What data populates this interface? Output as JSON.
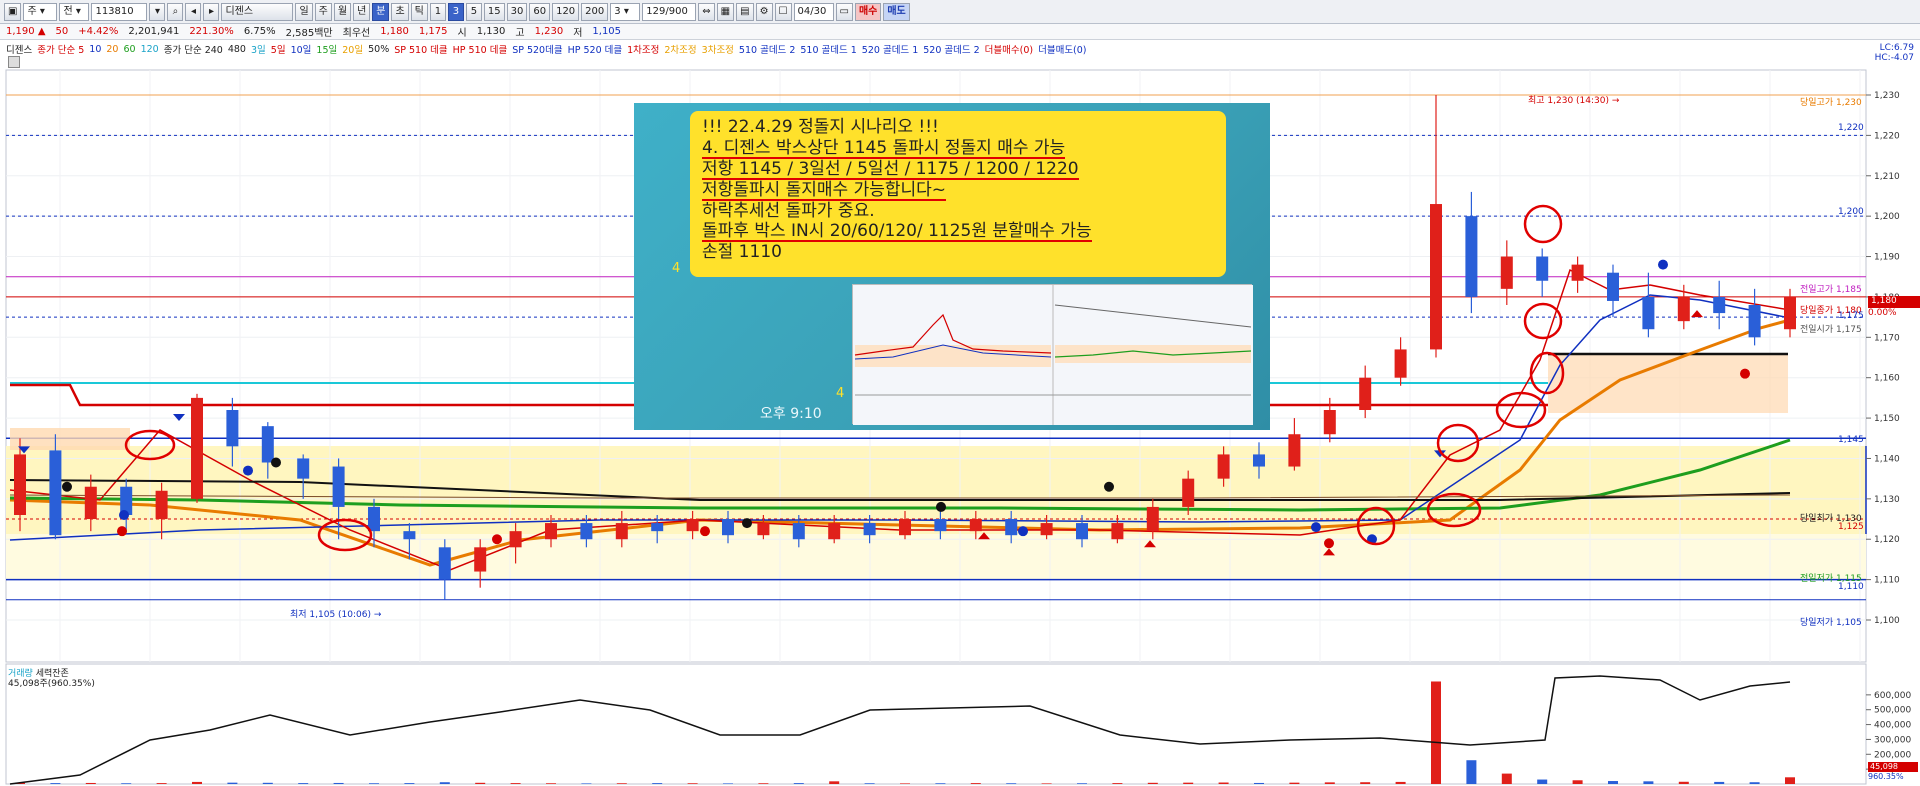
{
  "toolbar": {
    "code": "113810",
    "name": "디젠스",
    "periods": [
      "일",
      "주",
      "월",
      "년",
      "분",
      "초",
      "틱"
    ],
    "intervals": [
      "1",
      "3",
      "5",
      "15",
      "30",
      "60",
      "120",
      "200"
    ],
    "interval_select": "3",
    "page_count": "129/900",
    "date_box": "04/30",
    "buy": "매수",
    "sell": "매도",
    "sub_dropdown": "주",
    "sub_dropdown2": "전"
  },
  "quote": {
    "price": "1,190",
    "change": "50",
    "change_pct": "+4.42%",
    "volume": "2,201,941",
    "volume_pct": "221.30%",
    "turnover_pct": "6.75%",
    "amount": "2,585백만",
    "pref_label": "최우선",
    "ask": "1,180",
    "bid": "1,175",
    "open_label": "시",
    "open": "1,130",
    "high_label": "고",
    "high": "1,230",
    "low_label": "저",
    "low": "1,105"
  },
  "legend": [
    {
      "text": "디젠스",
      "color": "#222222"
    },
    {
      "text": "종가 단순 5",
      "color": "#d40000"
    },
    {
      "text": "10",
      "color": "#1030c0"
    },
    {
      "text": "20",
      "color": "#e87b00"
    },
    {
      "text": "60",
      "color": "#1e9e1e"
    },
    {
      "text": "120",
      "color": "#1aa3c8"
    },
    {
      "text": "종가 단순 240",
      "color": "#222222"
    },
    {
      "text": "480",
      "color": "#222222"
    },
    {
      "text": "3일",
      "color": "#1aa3c8"
    },
    {
      "text": "5일",
      "color": "#d40000"
    },
    {
      "text": "10일",
      "color": "#1030c0"
    },
    {
      "text": "15일",
      "color": "#1e9e1e"
    },
    {
      "text": "20일",
      "color": "#e8a000"
    },
    {
      "text": "50%",
      "color": "#222222"
    },
    {
      "text": "SP 510 데클",
      "color": "#d40000"
    },
    {
      "text": "HP 510 데클",
      "color": "#d40000"
    },
    {
      "text": "SP 520데클",
      "color": "#1030c0"
    },
    {
      "text": "HP 520 데클",
      "color": "#1030c0"
    },
    {
      "text": "1차조정",
      "color": "#d40000"
    },
    {
      "text": "2차조정",
      "color": "#e8a000"
    },
    {
      "text": "3차조정",
      "color": "#e8a000"
    },
    {
      "text": "510 골데드 2",
      "color": "#1030c0"
    },
    {
      "text": "510 골데드 1",
      "color": "#1030c0"
    },
    {
      "text": "520 골데드 1",
      "color": "#1030c0"
    },
    {
      "text": "520 골데드 2",
      "color": "#1030c0"
    },
    {
      "text": "더블매수(0)",
      "color": "#d40000"
    },
    {
      "text": "더블매도(0)",
      "color": "#1030c0"
    }
  ],
  "right_info": {
    "lc": "LC:6.79",
    "hc": "HC:-4.07"
  },
  "price_axis": {
    "ticks": [
      "1,230",
      "1,220",
      "1,210",
      "1,200",
      "1,190",
      "1,180",
      "1,170",
      "1,160",
      "1,150",
      "1,140",
      "1,130",
      "1,120",
      "1,110",
      "1,100"
    ],
    "tag_current": "1,180",
    "tag_pct": "0.00%"
  },
  "price_labels": {
    "high_today": "당일고가 1,230",
    "prev_high": "전일고가 1,185",
    "today_close_ref": "당일종가 1,180",
    "prev_open": "전일시가 1,175",
    "today_low_ref": "당일최가 1,130",
    "prev_low": "전일저가 1,115",
    "low_today": "당일저가 1,105",
    "lvl_1220": "1,220",
    "lvl_1200": "1,200",
    "lvl_1175": "1,175",
    "lvl_1145": "1,145",
    "lvl_1125": "1,125",
    "lvl_1110": "1,110",
    "max_marker": "최고 1,230 (14:30)",
    "min_marker": "최저 1,105 (10:06)"
  },
  "note": {
    "lines": [
      "!!! 22.4.29 정돌지 시나리오 !!!",
      "4. 디젠스 박스상단 1145 돌파시 정돌지 매수 가능",
      "저항 1145 / 3일선 / 5일선 / 1175 / 1200 / 1220",
      "저항돌파시 돌지매수 가능합니다~",
      "하락추세선 돌파가 중요.",
      "돌파후 박스 IN시 20/60/120/ 1125원 분할매수 가능",
      "손절 1110"
    ],
    "badge_left": "4",
    "badge_mid": "4",
    "time": "오후 9:10"
  },
  "volume_panel": {
    "title_a": "거래량",
    "title_b": "세력잔존",
    "sub": "45,098주(960.35%)",
    "ticks": [
      "600,000",
      "500,000",
      "400,000",
      "300,000",
      "200,000",
      "100,000"
    ],
    "tag_a": "45,098",
    "tag_b": "960.35%"
  }
}
